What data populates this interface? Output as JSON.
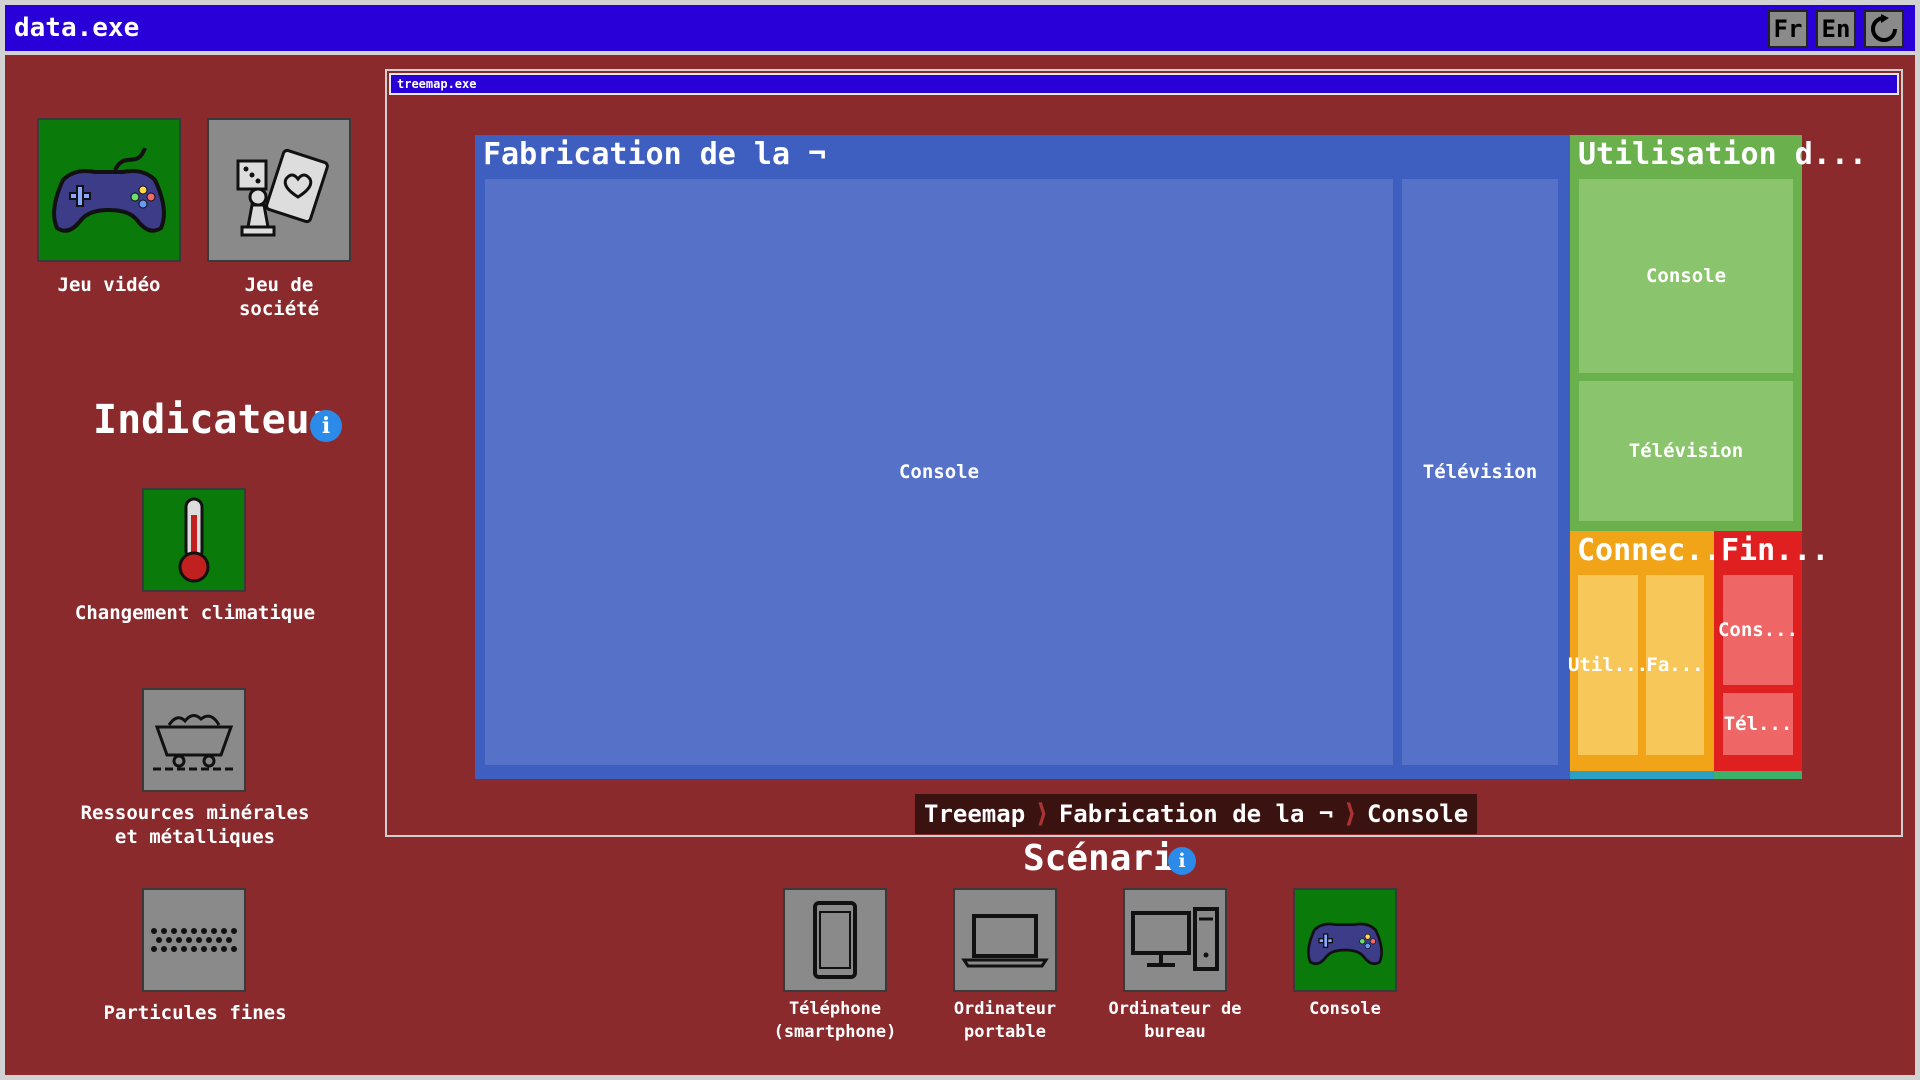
{
  "window": {
    "title": "data.exe"
  },
  "lang_buttons": [
    "Fr",
    "En"
  ],
  "reload_icon": "refresh-icon",
  "categories": [
    {
      "label": "Jeu vidéo",
      "icon": "gamepad-icon",
      "selected": true
    },
    {
      "label": "Jeu de société",
      "icon": "board-game-icon",
      "selected": false
    }
  ],
  "indicator": {
    "heading": "Indicateur",
    "items": [
      {
        "label": "Changement climatique",
        "icon": "thermometer-icon",
        "selected": true
      },
      {
        "label": "Ressources minérales et métalliques",
        "icon": "mine-cart-icon",
        "selected": false
      },
      {
        "label": "Particules fines",
        "icon": "particles-icon",
        "selected": false
      }
    ]
  },
  "treemap_window": {
    "title": "treemap.exe"
  },
  "treemap": {
    "groups": [
      {
        "label": "Fabrication de la ¬",
        "color": "#3f5fc0",
        "leaves": [
          "Console",
          "Télévision"
        ]
      },
      {
        "label": "Utilisation d...",
        "color": "#6ab04c",
        "leaves": [
          "Console",
          "Télévision"
        ]
      },
      {
        "label": "Connec...",
        "color": "#f1a418",
        "leaves": [
          "Util...",
          "Fa..."
        ]
      },
      {
        "label": "Fin...",
        "color": "#e02020",
        "leaves": [
          "Cons...",
          "Tél..."
        ]
      }
    ]
  },
  "breadcrumb": [
    "Treemap",
    "Fabrication de la ¬",
    "Console"
  ],
  "scenario": {
    "heading": "Scénario",
    "items": [
      {
        "label": "Téléphone (smartphone)",
        "icon": "smartphone-icon",
        "selected": false
      },
      {
        "label": "Ordinateur portable",
        "icon": "laptop-icon",
        "selected": false
      },
      {
        "label": "Ordinateur de bureau",
        "icon": "desktop-icon",
        "selected": false
      },
      {
        "label": "Console",
        "icon": "gamepad-icon",
        "selected": true
      }
    ]
  },
  "colors": {
    "background": "#8b2a2d",
    "titlebar": "#2a00d8",
    "selected_tile": "#0a7a0a",
    "unselected_tile": "#8a8a8a"
  }
}
